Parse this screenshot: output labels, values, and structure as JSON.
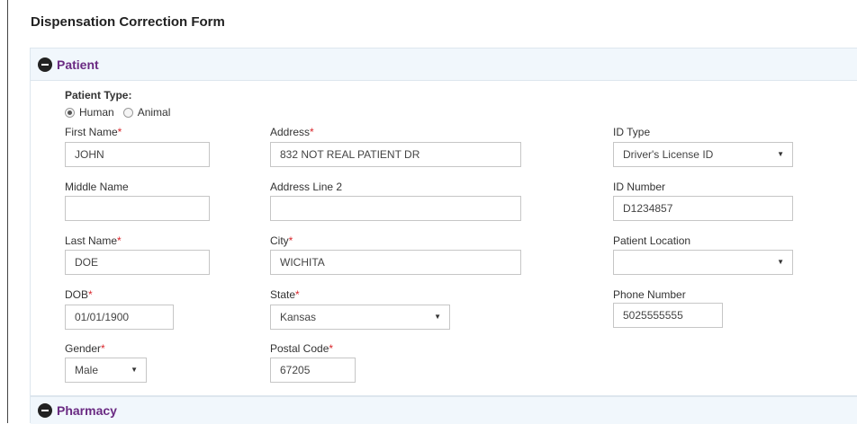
{
  "form": {
    "title": "Dispensation Correction Form"
  },
  "sections": {
    "patient": "Patient",
    "pharmacy": "Pharmacy"
  },
  "patient_type": {
    "label": "Patient Type:",
    "options": [
      "Human",
      "Animal"
    ],
    "selected": "Human"
  },
  "fields": {
    "first_name": {
      "label": "First Name",
      "value": "JOHN",
      "required": "*"
    },
    "middle_name": {
      "label": "Middle Name",
      "value": ""
    },
    "last_name": {
      "label": "Last Name",
      "value": "DOE",
      "required": "*"
    },
    "dob": {
      "label": "DOB",
      "value": "01/01/1900",
      "required": "*"
    },
    "gender": {
      "label": "Gender",
      "value": "Male",
      "required": "*"
    },
    "address": {
      "label": "Address",
      "value": "832 NOT REAL PATIENT DR",
      "required": "*"
    },
    "address_line2": {
      "label": "Address Line 2",
      "value": ""
    },
    "city": {
      "label": "City",
      "value": "WICHITA",
      "required": "*"
    },
    "state": {
      "label": "State",
      "value": "Kansas",
      "required": "*"
    },
    "postal_code": {
      "label": "Postal Code",
      "value": "67205",
      "required": "*"
    },
    "id_type": {
      "label": "ID Type",
      "value": "Driver's License ID"
    },
    "id_number": {
      "label": "ID Number",
      "value": "D1234857"
    },
    "patient_location": {
      "label": "Patient Location",
      "value": ""
    },
    "phone_number": {
      "label": "Phone Number",
      "value": "5025555555"
    }
  },
  "icons": {
    "section_toggle": "minus-circle-icon",
    "dropdown": "caret-down-icon"
  },
  "colors": {
    "section_title": "#6a2a82",
    "required": "#d9262b",
    "header_bg": "#f1f7fc"
  }
}
